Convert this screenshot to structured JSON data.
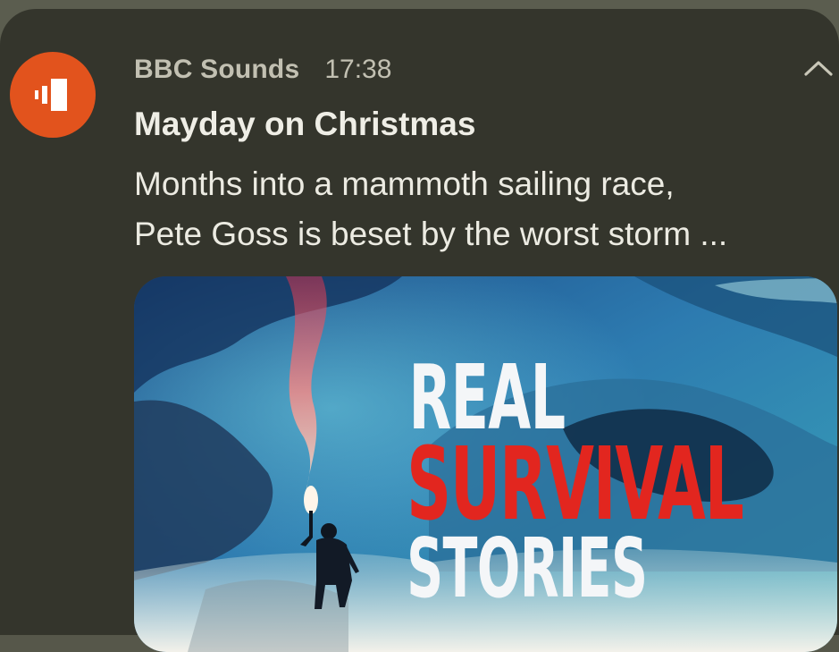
{
  "notification": {
    "app_icon": "bbc-sounds-icon",
    "app_name": "BBC Sounds",
    "time": "17:38",
    "collapse_icon": "chevron-up-icon",
    "title": "Mayday on Christmas",
    "body_lines": [
      "Months into a mammoth sailing race,",
      "Pete Goss is beset by the worst storm ..."
    ],
    "artwork": {
      "line1": "REAL",
      "line2": "SURVIVAL",
      "line3": "STORIES"
    },
    "colors": {
      "accent": "#e2531d",
      "card_background": "#34352c",
      "title_red": "#e2261f"
    }
  }
}
